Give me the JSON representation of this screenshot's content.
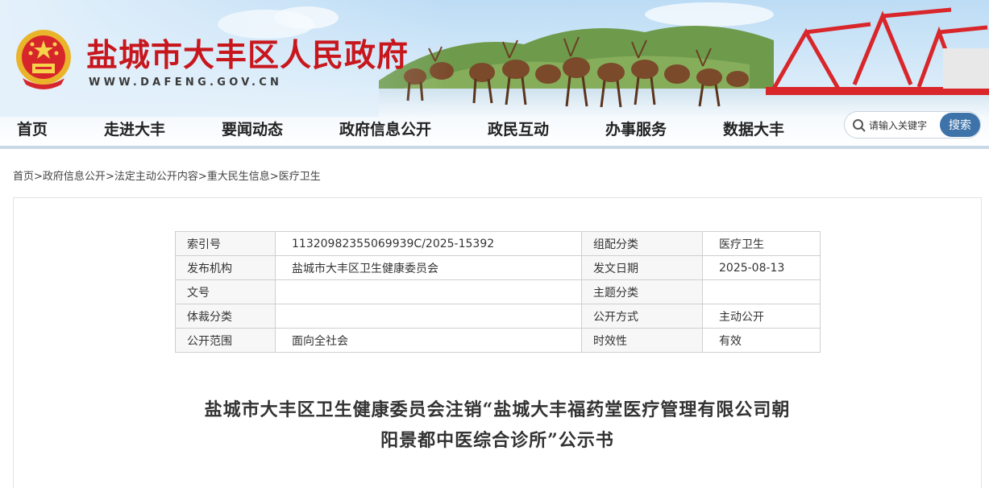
{
  "header": {
    "site_title": "盐城市大丰区人民政府",
    "site_url": "WWW.DAFENG.GOV.CN"
  },
  "nav": {
    "items": [
      "首页",
      "走进大丰",
      "要闻动态",
      "政府信息公开",
      "政民互动",
      "办事服务",
      "数据大丰"
    ]
  },
  "search": {
    "placeholder": "请输入关键字",
    "button_label": "搜索"
  },
  "breadcrumb": {
    "items": [
      "首页",
      "政府信息公开",
      "法定主动公开内容",
      "重大民生信息",
      "医疗卫生"
    ],
    "separator": ">"
  },
  "meta_table": {
    "rows": [
      [
        "索引号",
        "11320982355069939C/2025-15392",
        "组配分类",
        "医疗卫生"
      ],
      [
        "发布机构",
        "盐城市大丰区卫生健康委员会",
        "发文日期",
        "2025-08-13"
      ],
      [
        "文号",
        "",
        "主题分类",
        ""
      ],
      [
        "体裁分类",
        "",
        "公开方式",
        "主动公开"
      ],
      [
        "公开范围",
        "面向全社会",
        "时效性",
        "有效"
      ]
    ]
  },
  "article": {
    "title_line1": "盐城市大丰区卫生健康委员会注销“盐城大丰福药堂医疗管理有限公司朝",
    "title_line2": "阳景都中医综合诊所”公示书"
  },
  "colors": {
    "title_red": "#c8161d",
    "search_button": "#3e73aa",
    "nav_underline": "#c9d8e6"
  }
}
